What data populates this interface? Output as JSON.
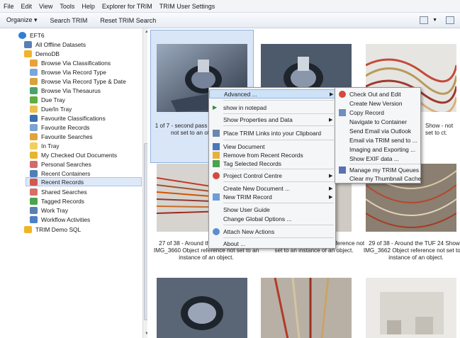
{
  "menubar": [
    "File",
    "Edit",
    "View",
    "Tools",
    "Help",
    "Explorer for TRIM",
    "TRIM User Settings"
  ],
  "toolbar": {
    "organize": "Organize ▾",
    "search": "Search TRIM",
    "reset": "Reset TRIM Search"
  },
  "tree": {
    "root": "EFT6",
    "offline": "All Offline Datasets",
    "db": "DemoDB",
    "items": [
      "Browse Via Classifications",
      "Browse Via Record Type",
      "Browse Via Record Type & Date",
      "Browse Via Thesaurus",
      "Due Tray",
      "Due/In Tray",
      "Favourite Classifications",
      "Favourite Records",
      "Favourite Searches",
      "In Tray",
      "My Checked Out Documents",
      "Personal Searches",
      "Recent Containers",
      "Recent Records",
      "Shared Searches",
      "Tagged Records",
      "Work Tray",
      "Workflow Activities"
    ],
    "demo_sql": "TRIM Demo SQL"
  },
  "gallery": {
    "captions": [
      "1 of 7 - second pass Object reference not set to an of an object.",
      "Show - not set to ct.",
      "27 of 38 - Around the TUF 24 Show - IMG_3660 Object reference not set to an instance of an object.",
      "Show - IMG_3661 Object reference not set to an instance of an object.",
      "29 of 38 - Around the TUF 24 Show - IMG_3662 Object reference not set to an instance of an object."
    ]
  },
  "context_menu": [
    "Advanced ...",
    "show in notepad",
    "Show Properties and Data",
    "Place TRIM Links into your Clipboard",
    "View Document",
    "Remove from Recent Records",
    "Tag Selected Records",
    "Project Control Centre",
    "Create New Document ...",
    "New TRIM Record",
    "Show User Guide",
    "Change Global Options ...",
    "Attach New Actions",
    "About ..."
  ],
  "submenu": [
    "Check Out and Edit",
    "Create New Version",
    "Copy Record",
    "Navigate to Container",
    "Send Email via Outlook",
    "Email via TRIM send to ...",
    "Imaging and Exporting ...",
    "Show EXIF data ...",
    "Manage my TRIM Queues",
    "Clear my Thumbnail Cache"
  ]
}
